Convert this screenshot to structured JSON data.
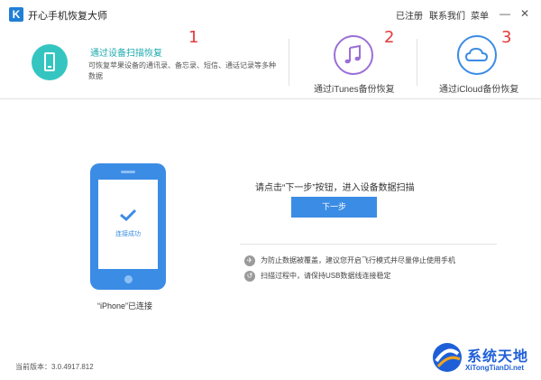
{
  "titlebar": {
    "logo_letter": "K",
    "app_title": "开心手机恢复大师",
    "menu": [
      "已注册",
      "联系我们",
      "菜单"
    ],
    "minimize": "—",
    "close": "✕"
  },
  "modes": [
    {
      "title": "通过设备扫描恢复",
      "desc": "可恢复苹果设备的通讯录、备忘录、短信、通话记录等多种数据",
      "icon": "phone-icon",
      "annotation": "1",
      "active": true
    },
    {
      "title": "通过iTunes备份恢复",
      "icon": "music-note-icon",
      "annotation": "2",
      "color": "#9b6fd6"
    },
    {
      "title": "通过iCloud备份恢复",
      "icon": "cloud-icon",
      "annotation": "3",
      "color": "#3b8ce5"
    }
  ],
  "device": {
    "screen_text": "连接成功",
    "status": "“iPhone”已连接"
  },
  "main": {
    "instruction": "请点击“下一步”按钮，进入设备数据扫描",
    "next_button": "下一步",
    "tips": [
      {
        "icon": "airplane-icon",
        "text": "为防止数据被覆盖，建议您开启飞行模式并尽量停止使用手机"
      },
      {
        "icon": "usb-icon",
        "text": "扫描过程中，请保持USB数据线连接稳定"
      }
    ]
  },
  "footer": {
    "version": "当前版本：3.0.4917.812"
  },
  "watermark": {
    "title": "系统天地",
    "url": "XiTongTianDi.net"
  },
  "colors": {
    "accent": "#3b8ce5",
    "teal": "#35c5c1",
    "annotation": "#e23a3a"
  }
}
